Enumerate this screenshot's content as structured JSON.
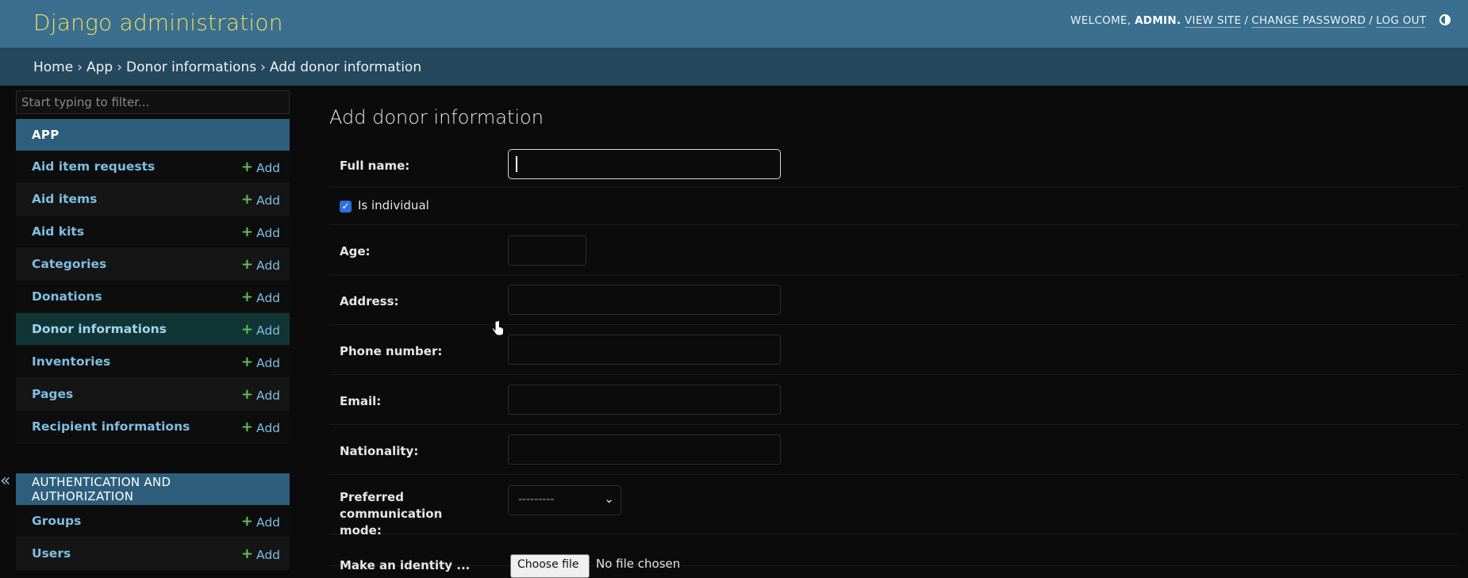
{
  "header": {
    "branding": "Django administration",
    "welcome": "WELCOME,",
    "username": "ADMIN.",
    "view_site": "VIEW SITE",
    "change_password": "CHANGE PASSWORD",
    "log_out": "LOG OUT",
    "separator": "/",
    "theme_icon": "half-circle-icon"
  },
  "breadcrumbs": {
    "items": [
      "Home",
      "App",
      "Donor informations",
      "Add donor information"
    ],
    "separator": "›"
  },
  "sidebar": {
    "filter_placeholder": "Start typing to filter...",
    "add_label": "Add",
    "app_module": {
      "caption": "APP",
      "models": [
        "Aid item requests",
        "Aid items",
        "Aid kits",
        "Categories",
        "Donations",
        "Donor informations",
        "Inventories",
        "Pages",
        "Recipient informations"
      ],
      "current": "Donor informations"
    },
    "auth_module": {
      "caption": "AUTHENTICATION AND AUTHORIZATION",
      "models": [
        "Groups",
        "Users"
      ]
    },
    "collapse_toggle": "«"
  },
  "content": {
    "title": "Add donor information",
    "fields": {
      "full_name": {
        "label": "Full name:",
        "value": ""
      },
      "is_individual": {
        "label": "Is individual",
        "checked": true
      },
      "age": {
        "label": "Age:",
        "value": ""
      },
      "address": {
        "label": "Address:",
        "value": ""
      },
      "phone_number": {
        "label": "Phone number:",
        "value": ""
      },
      "email": {
        "label": "Email:",
        "value": ""
      },
      "nationality": {
        "label": "Nationality:",
        "value": ""
      },
      "preferred_communication_mode": {
        "label_line1": "Preferred communication",
        "label_line2": "mode:",
        "selected": "---------"
      },
      "file": {
        "label": "Make an identity ...",
        "button": "Choose file",
        "status": "No file chosen"
      }
    }
  },
  "colors": {
    "header_bg": "#3a6f8f",
    "breadcrumb_bg": "#26485d",
    "branding": "#f5dd5d",
    "link": "#7fbde3",
    "add_plus": "#57c34b",
    "page_bg": "#0b0b0b"
  }
}
